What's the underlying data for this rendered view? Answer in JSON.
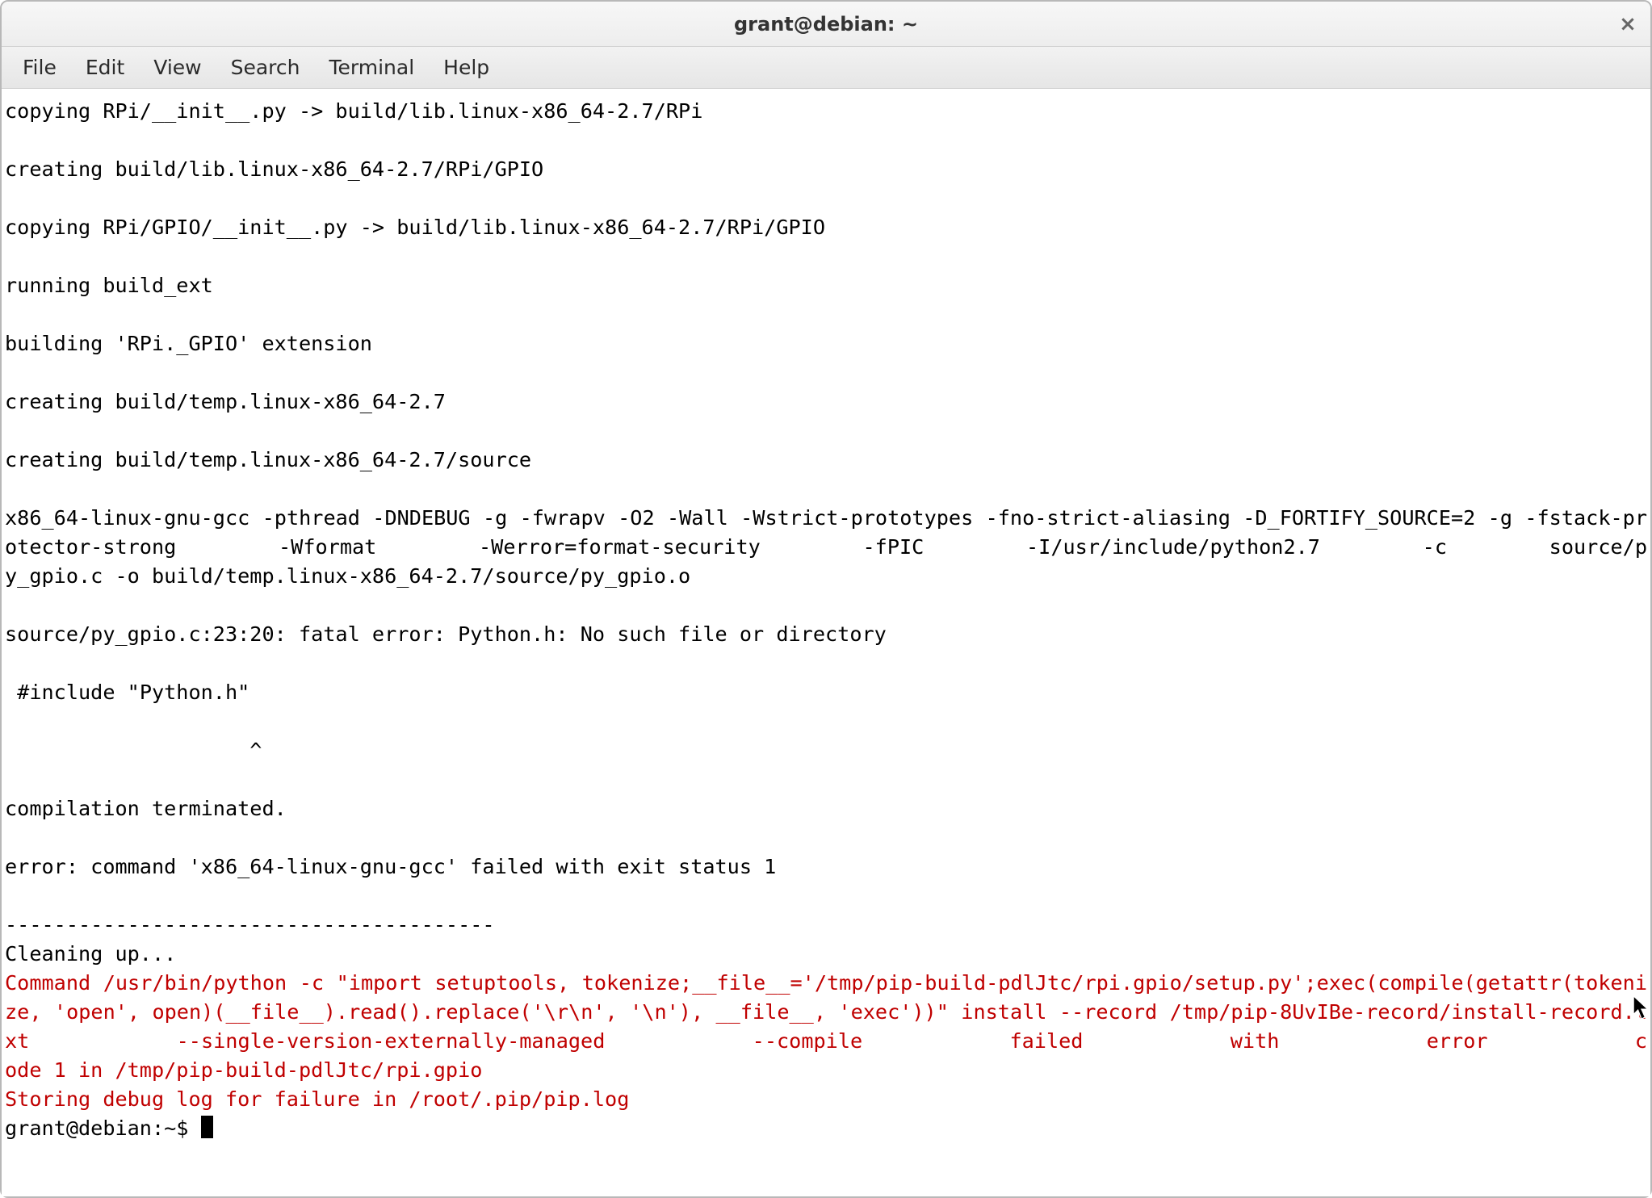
{
  "window": {
    "title": "grant@debian: ~",
    "close_glyph": "×"
  },
  "menubar": {
    "items": [
      "File",
      "Edit",
      "View",
      "Search",
      "Terminal",
      "Help"
    ]
  },
  "terminal": {
    "lines": [
      {
        "cls": "term-norm",
        "text": "copying RPi/__init__.py -> build/lib.linux-x86_64-2.7/RPi"
      },
      {
        "cls": "term-norm",
        "text": ""
      },
      {
        "cls": "term-norm",
        "text": "creating build/lib.linux-x86_64-2.7/RPi/GPIO"
      },
      {
        "cls": "term-norm",
        "text": ""
      },
      {
        "cls": "term-norm",
        "text": "copying RPi/GPIO/__init__.py -> build/lib.linux-x86_64-2.7/RPi/GPIO"
      },
      {
        "cls": "term-norm",
        "text": ""
      },
      {
        "cls": "term-norm",
        "text": "running build_ext"
      },
      {
        "cls": "term-norm",
        "text": ""
      },
      {
        "cls": "term-norm",
        "text": "building 'RPi._GPIO' extension"
      },
      {
        "cls": "term-norm",
        "text": ""
      },
      {
        "cls": "term-norm",
        "text": "creating build/temp.linux-x86_64-2.7"
      },
      {
        "cls": "term-norm",
        "text": ""
      },
      {
        "cls": "term-norm",
        "text": "creating build/temp.linux-x86_64-2.7/source"
      },
      {
        "cls": "term-norm",
        "text": ""
      },
      {
        "cls": "term-just",
        "text": "x86_64-linux-gnu-gcc -pthread -DNDEBUG -g -fwrapv -O2 -Wall -Wstrict-prototypes -fno-strict-aliasing -D_FORTIFY_SOURCE=2 -g -fstack-protector-strong -Wformat -Werror=format-security -fPIC -I/usr/include/python2.7 -c source/p"
      },
      {
        "cls": "term-norm",
        "text": "y_gpio.c -o build/temp.linux-x86_64-2.7/source/py_gpio.o"
      },
      {
        "cls": "term-norm",
        "text": ""
      },
      {
        "cls": "term-norm",
        "text": "source/py_gpio.c:23:20: fatal error: Python.h: No such file or directory"
      },
      {
        "cls": "term-norm",
        "text": ""
      },
      {
        "cls": "term-norm",
        "text": " #include \"Python.h\""
      },
      {
        "cls": "term-norm",
        "text": ""
      },
      {
        "cls": "term-norm",
        "text": "                    ^"
      },
      {
        "cls": "term-norm",
        "text": ""
      },
      {
        "cls": "term-norm",
        "text": "compilation terminated."
      },
      {
        "cls": "term-norm",
        "text": ""
      },
      {
        "cls": "term-norm",
        "text": "error: command 'x86_64-linux-gnu-gcc' failed with exit status 1"
      },
      {
        "cls": "term-norm",
        "text": ""
      },
      {
        "cls": "term-norm",
        "text": "----------------------------------------"
      },
      {
        "cls": "term-norm",
        "text": "Cleaning up..."
      },
      {
        "cls": "term-red term-just",
        "text": "Command /usr/bin/python -c \"import setuptools, tokenize;__file__='/tmp/pip-build-pdlJtc/rpi.gpio/setup.py';exec(compile(getattr(tokenize, 'open', open)(__file__).read().replace('\\r\\n', '\\n'), __file__, 'exec'))\" install --record /tmp/pip-8UvIBe-record/install-record.txt --single-version-externally-managed --compile failed with error c"
      },
      {
        "cls": "term-red term-norm",
        "text": "ode 1 in /tmp/pip-build-pdlJtc/rpi.gpio"
      },
      {
        "cls": "term-red term-norm",
        "text": "Storing debug log for failure in /root/.pip/pip.log"
      }
    ],
    "prompt": "grant@debian:~$ "
  }
}
